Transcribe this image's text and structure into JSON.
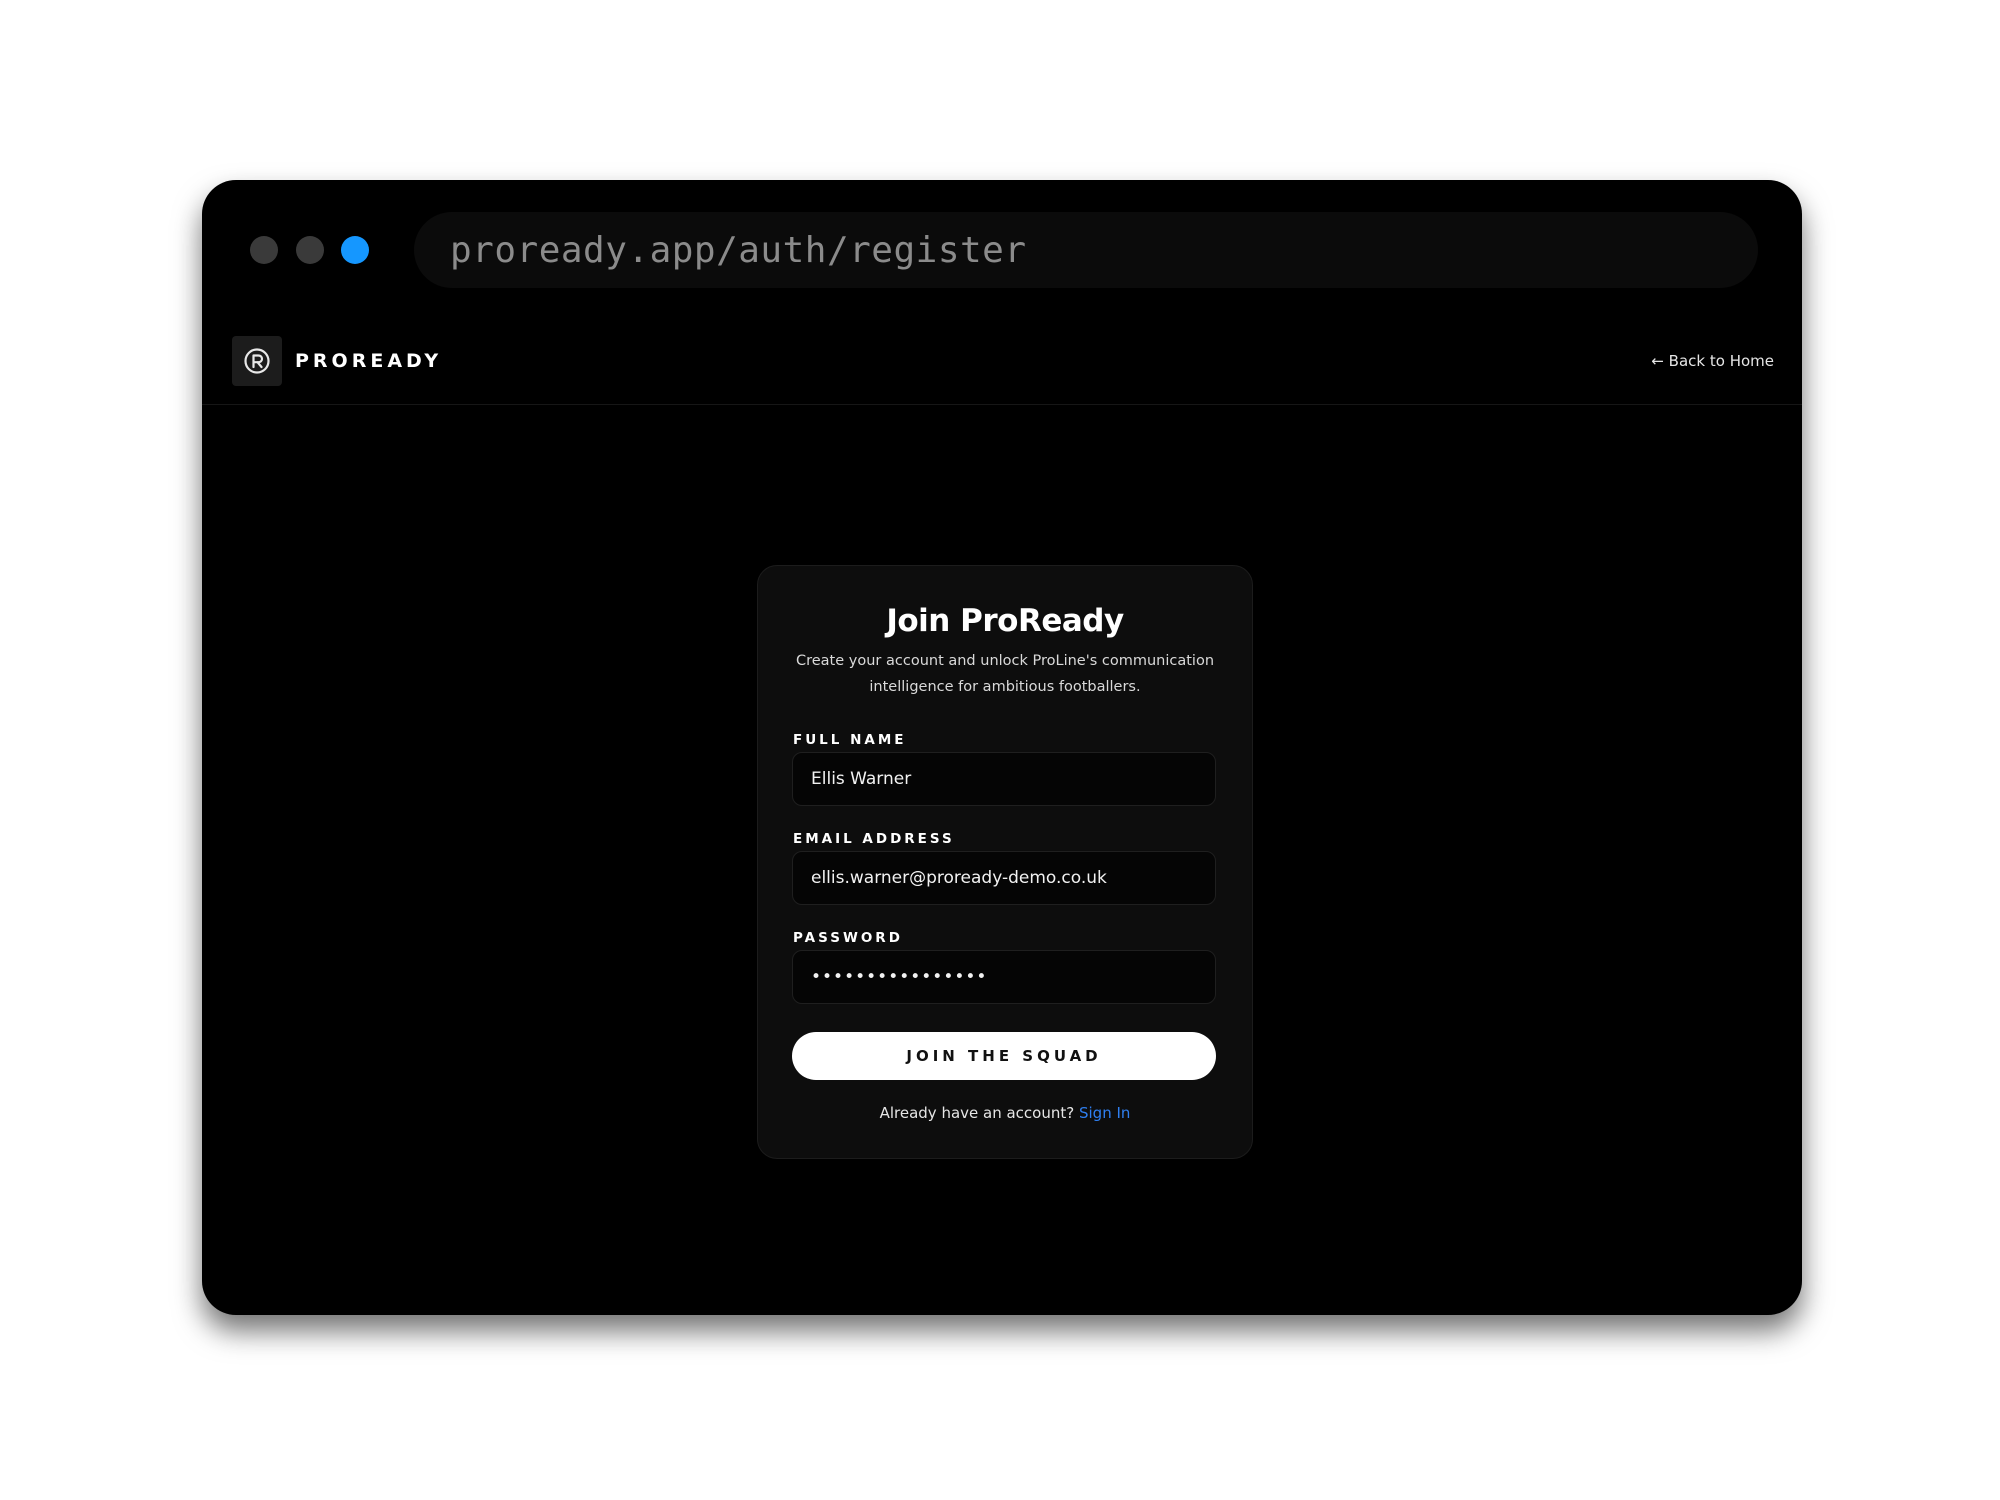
{
  "browser": {
    "url": "proready.app/auth/register",
    "traffic_lights": [
      {
        "name": "close",
        "color": "#3a3a3a"
      },
      {
        "name": "minimize",
        "color": "#3a3a3a"
      },
      {
        "name": "maximize",
        "color": "#1597ff"
      }
    ]
  },
  "header": {
    "logo_icon": "proready-logo-icon",
    "brand": "PROREADY",
    "back_link": "← Back to Home"
  },
  "register_form": {
    "title": "Join ProReady",
    "subtitle": "Create your account and unlock ProLine's communication intelligence for ambitious footballers.",
    "fields": {
      "full_name": {
        "label": "FULL NAME",
        "value": "Ellis Warner"
      },
      "email": {
        "label": "EMAIL ADDRESS",
        "value": "ellis.warner@proready-demo.co.uk"
      },
      "password": {
        "label": "PASSWORD",
        "value": "••••••••••••••••"
      }
    },
    "submit_label": "JOIN THE SQUAD",
    "signin_prompt": "Already have an account?",
    "signin_link": "Sign In"
  },
  "colors": {
    "background": "#000000",
    "card": "#0d0d0d",
    "accent_link": "#2f7ff0",
    "button_bg": "#ffffff"
  }
}
